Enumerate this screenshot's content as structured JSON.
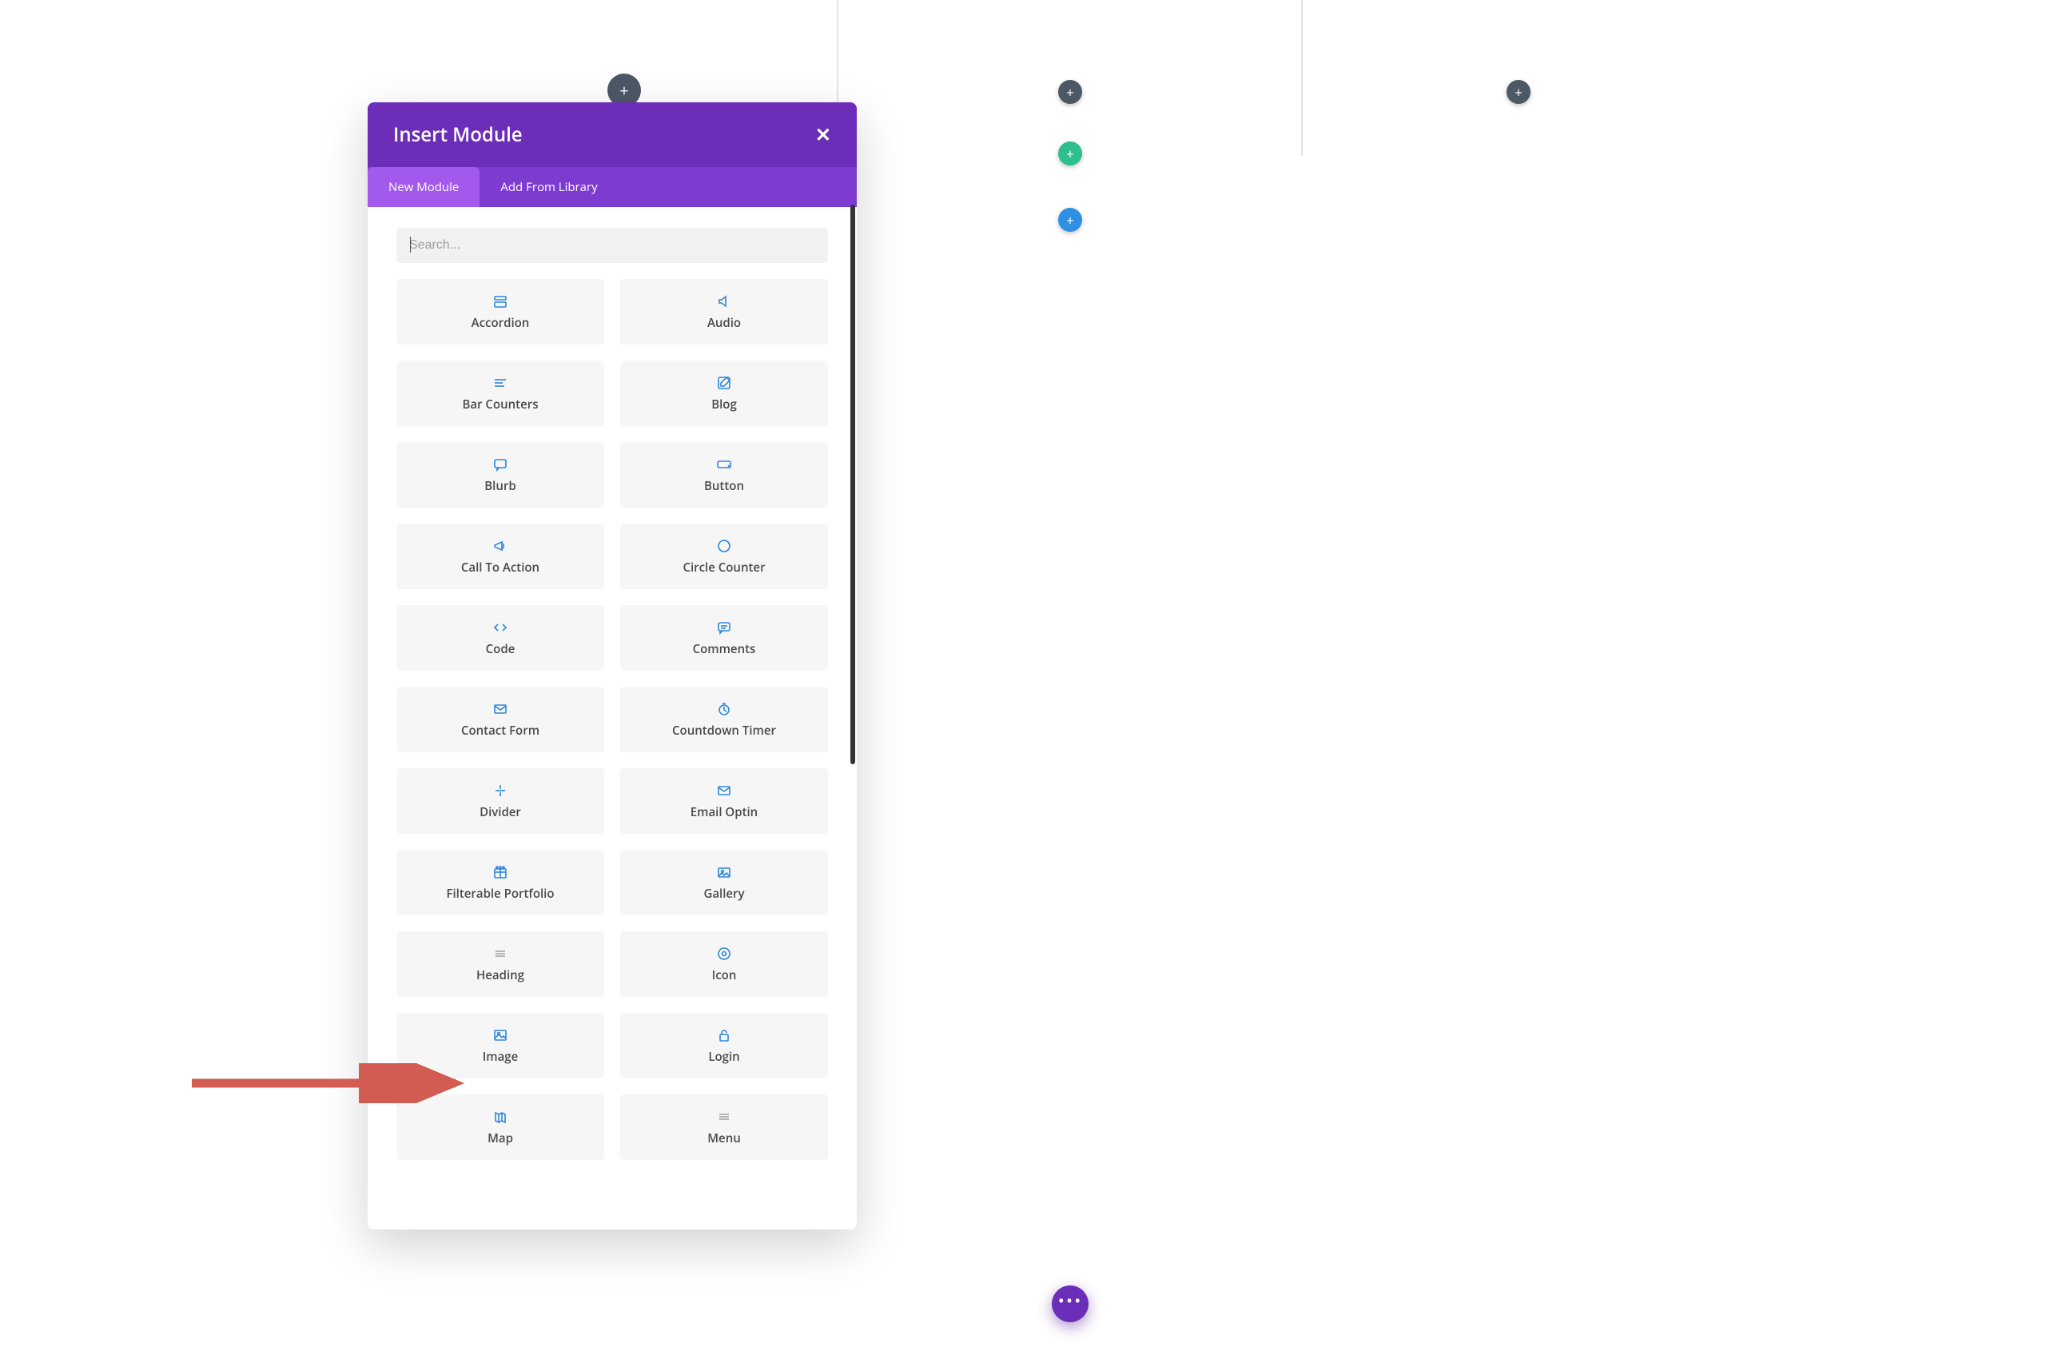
{
  "builder": {
    "add_glyph": "+"
  },
  "modal": {
    "title": "Insert Module",
    "close_glyph": "✕",
    "tabs": {
      "new_module": "New Module",
      "add_from_library": "Add From Library"
    },
    "search_placeholder": "Search...",
    "modules": [
      {
        "label": "Accordion",
        "icon": "accordion"
      },
      {
        "label": "Audio",
        "icon": "audio"
      },
      {
        "label": "Bar Counters",
        "icon": "bar-counters"
      },
      {
        "label": "Blog",
        "icon": "blog"
      },
      {
        "label": "Blurb",
        "icon": "blurb"
      },
      {
        "label": "Button",
        "icon": "button"
      },
      {
        "label": "Call To Action",
        "icon": "megaphone"
      },
      {
        "label": "Circle Counter",
        "icon": "circle-counter"
      },
      {
        "label": "Code",
        "icon": "code"
      },
      {
        "label": "Comments",
        "icon": "comments"
      },
      {
        "label": "Contact Form",
        "icon": "mail"
      },
      {
        "label": "Countdown Timer",
        "icon": "countdown"
      },
      {
        "label": "Divider",
        "icon": "divider"
      },
      {
        "label": "Email Optin",
        "icon": "mail"
      },
      {
        "label": "Filterable Portfolio",
        "icon": "portfolio"
      },
      {
        "label": "Gallery",
        "icon": "gallery"
      },
      {
        "label": "Heading",
        "icon": "heading"
      },
      {
        "label": "Icon",
        "icon": "target"
      },
      {
        "label": "Image",
        "icon": "image"
      },
      {
        "label": "Login",
        "icon": "lock"
      },
      {
        "label": "Map",
        "icon": "map"
      },
      {
        "label": "Menu",
        "icon": "menu"
      }
    ]
  },
  "floating_more_glyph": "•••"
}
